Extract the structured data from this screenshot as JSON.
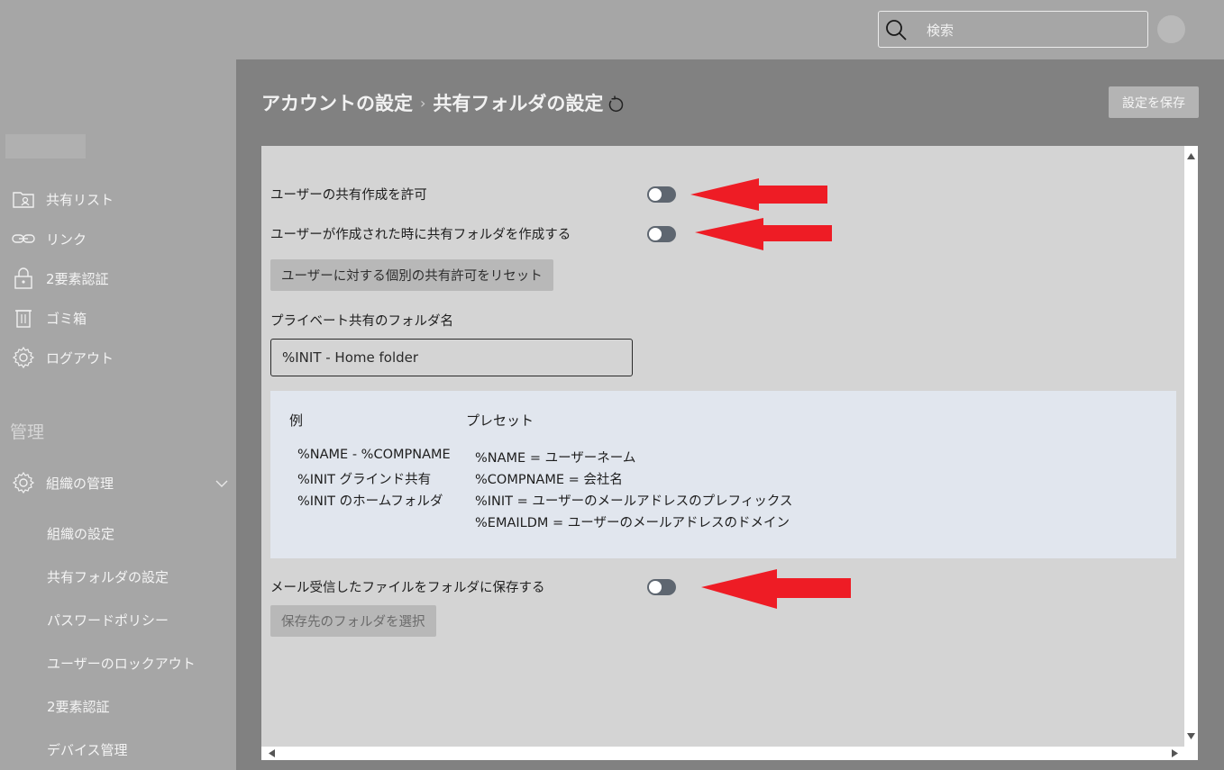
{
  "header": {
    "search_placeholder": "検索"
  },
  "sidebar": {
    "items": [
      {
        "label": "共有リスト",
        "icon": "shared-list-icon"
      },
      {
        "label": "リンク",
        "icon": "link-icon"
      },
      {
        "label": "2要素認証",
        "icon": "lock-icon"
      },
      {
        "label": "ゴミ箱",
        "icon": "trash-icon"
      },
      {
        "label": "ログアウト",
        "icon": "gear-icon"
      }
    ],
    "section_title": "管理",
    "org_menu": {
      "label": "組織の管理",
      "icon": "gear-icon",
      "expanded": true
    },
    "sub_items": [
      "組織の設定",
      "共有フォルダの設定",
      "パスワードポリシー",
      "ユーザーのロックアウト",
      "2要素認証",
      "デバイス管理"
    ]
  },
  "main": {
    "breadcrumb": {
      "parent": "アカウントの設定",
      "separator": "›",
      "current": "共有フォルダの設定"
    },
    "save_button": "設定を保存",
    "settings": {
      "allow_share_label": "ユーザーの共有作成を許可",
      "create_folder_label": "ユーザーが作成された時に共有フォルダを作成する",
      "reset_button": "ユーザーに対する個別の共有許可をリセット",
      "folder_name_label": "プライベート共有のフォルダ名",
      "folder_name_value": "%INIT - Home folder",
      "save_mail_label": "メール受信したファイルをフォルダに保存する",
      "select_folder_button": "保存先のフォルダを選択"
    },
    "info": {
      "example_header": "例",
      "preset_header": "プレセット",
      "examples": [
        "%NAME - %COMPNAME",
        "%INIT グラインド共有",
        "%INIT のホームフォルダ"
      ],
      "presets": [
        "%NAME = ユーザーネーム",
        "%COMPNAME = 会社名",
        "%INIT = ユーザーのメールアドレスのプレフィックス",
        "%EMAILDM = ユーザーのメールアドレスのドメイン"
      ]
    }
  },
  "colors": {
    "annotation_arrow": "#ee1c25",
    "toggle_off": "#5e6670",
    "info_box": "#e1e6ee"
  }
}
